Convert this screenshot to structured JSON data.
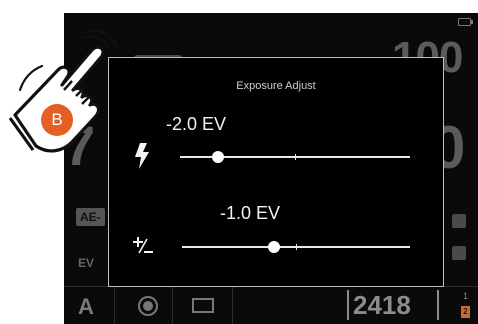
{
  "background": {
    "iso_value": "100",
    "mode": "A",
    "ae_tag": "AE-",
    "ev_tag": "EV",
    "shots_remaining": "2418",
    "card_slot_number": "1",
    "card_slot_badge": "2"
  },
  "dialog": {
    "title": "Exposure Adjust",
    "flash_compensation": {
      "label": "-2.0 EV",
      "value_ev": -2.0,
      "icon": "flash-icon"
    },
    "exposure_compensation": {
      "label": "-1.0 EV",
      "value_ev": -1.0,
      "icon": "plus-minus-icon"
    }
  },
  "overlay": {
    "gesture_icon": "tap-hand-icon",
    "button_label": "B",
    "button_color": "#e35f23"
  }
}
